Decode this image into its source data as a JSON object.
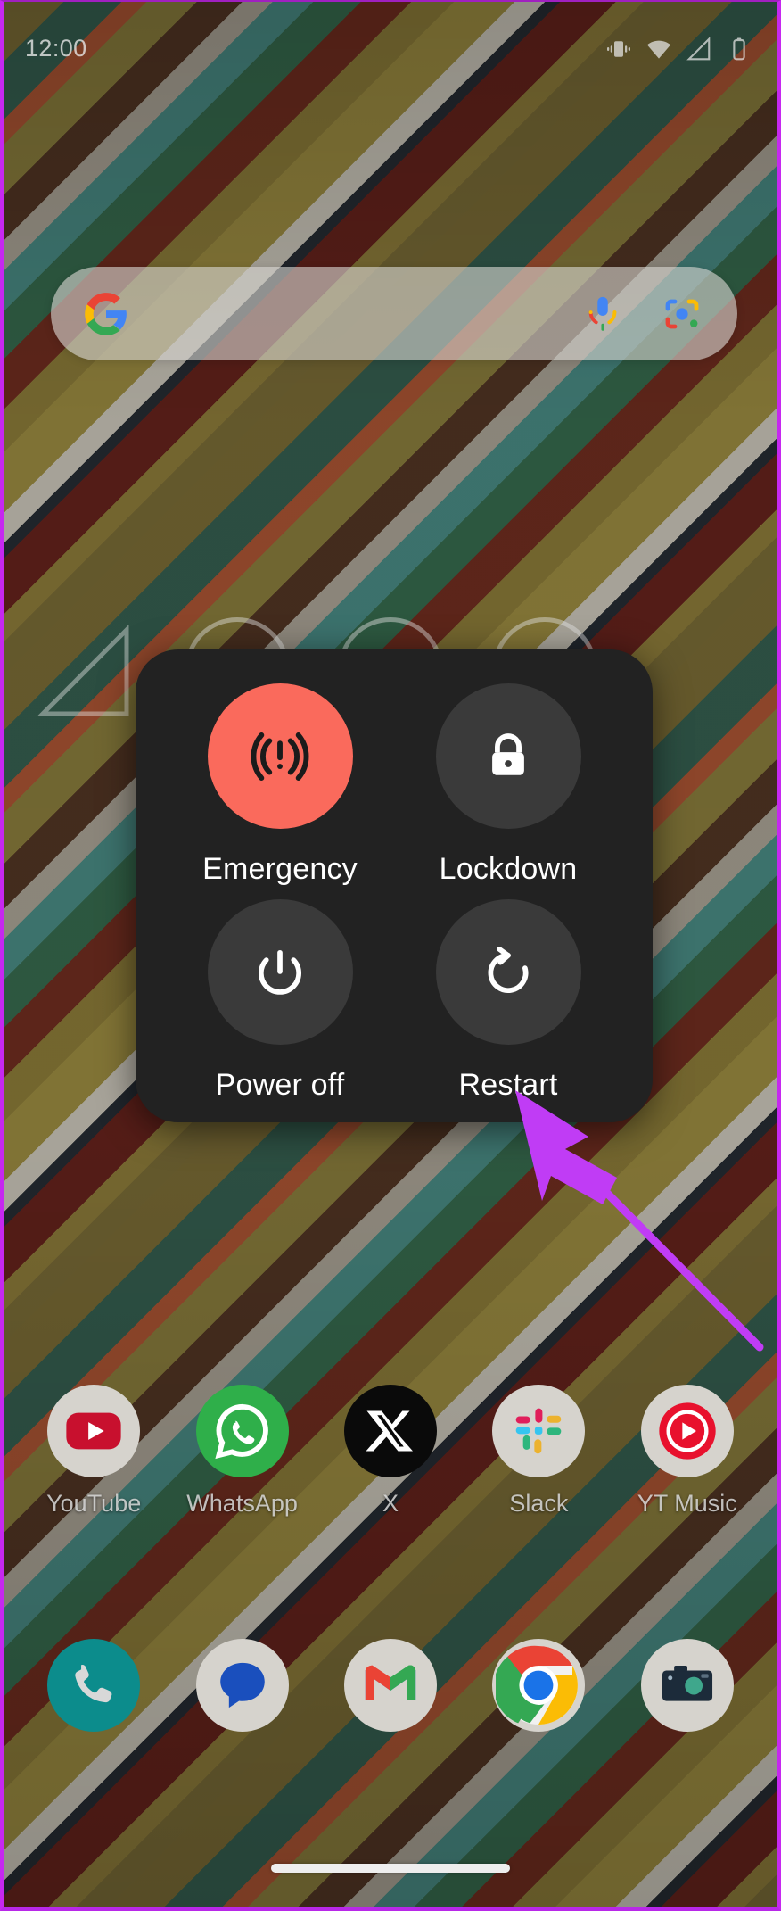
{
  "statusbar": {
    "time": "12:00",
    "icons": [
      {
        "name": "vibrate-icon",
        "label": "vibrate"
      },
      {
        "name": "wifi-icon",
        "label": "wifi"
      },
      {
        "name": "cellular-signal-icon",
        "label": "signal"
      },
      {
        "name": "battery-icon",
        "label": "battery"
      }
    ]
  },
  "search": {
    "placeholder": "",
    "value": "",
    "google_logo": "google-g-logo",
    "mic": "microphone-icon",
    "lens": "google-lens-icon"
  },
  "power_menu": {
    "items": [
      {
        "id": "emergency",
        "label": "Emergency",
        "icon": "emergency-broadcast-icon",
        "accent": "#fa6a5c"
      },
      {
        "id": "lockdown",
        "label": "Lockdown",
        "icon": "lock-icon",
        "accent": "#3a3a3a"
      },
      {
        "id": "power-off",
        "label": "Power off",
        "icon": "power-icon",
        "accent": "#3a3a3a"
      },
      {
        "id": "restart",
        "label": "Restart",
        "icon": "restart-icon",
        "accent": "#3a3a3a"
      }
    ],
    "background": "#222222"
  },
  "annotation": {
    "color": "#c03cf5",
    "points_to": "Restart"
  },
  "app_row": [
    {
      "id": "youtube",
      "label": "YouTube",
      "icon": "youtube-icon"
    },
    {
      "id": "whatsapp",
      "label": "WhatsApp",
      "icon": "whatsapp-icon"
    },
    {
      "id": "x",
      "label": "X",
      "icon": "x-twitter-icon"
    },
    {
      "id": "slack",
      "label": "Slack",
      "icon": "slack-icon"
    },
    {
      "id": "ytmusic",
      "label": "YT Music",
      "icon": "youtube-music-icon"
    }
  ],
  "dock_row": [
    {
      "id": "phone",
      "label": "",
      "icon": "phone-icon"
    },
    {
      "id": "messages",
      "label": "",
      "icon": "messages-icon"
    },
    {
      "id": "gmail",
      "label": "",
      "icon": "gmail-icon"
    },
    {
      "id": "chrome",
      "label": "",
      "icon": "chrome-icon"
    },
    {
      "id": "camera",
      "label": "",
      "icon": "camera-icon"
    }
  ],
  "navigation": {
    "home_indicator": "home-gesture-bar"
  }
}
